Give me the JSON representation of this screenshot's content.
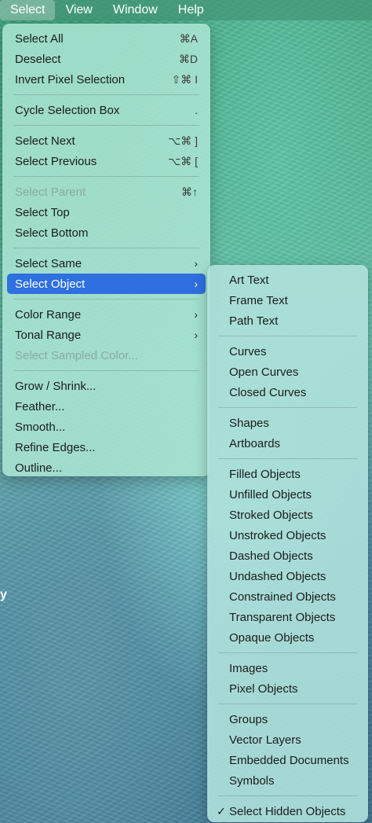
{
  "menubar": {
    "items": [
      {
        "label": "Select"
      },
      {
        "label": "View"
      },
      {
        "label": "Window"
      },
      {
        "label": "Help"
      }
    ]
  },
  "select_menu": {
    "items": [
      {
        "label": "Select All",
        "shortcut": "⌘A"
      },
      {
        "label": "Deselect",
        "shortcut": "⌘D"
      },
      {
        "label": "Invert Pixel Selection",
        "shortcut": "⇧⌘ I"
      },
      {
        "label": "Cycle Selection Box",
        "shortcut": "."
      },
      {
        "label": "Select Next",
        "shortcut": "⌥⌘ ]"
      },
      {
        "label": "Select Previous",
        "shortcut": "⌥⌘ ["
      },
      {
        "label": "Select Parent",
        "shortcut": "⌘↑"
      },
      {
        "label": "Select Top",
        "shortcut": ""
      },
      {
        "label": "Select Bottom",
        "shortcut": ""
      },
      {
        "label": "Select Same",
        "arrow": "›"
      },
      {
        "label": "Select Object",
        "arrow": "›"
      },
      {
        "label": "Color Range",
        "arrow": "›"
      },
      {
        "label": "Tonal Range",
        "arrow": "›"
      },
      {
        "label": "Select Sampled Color..."
      },
      {
        "label": "Grow / Shrink..."
      },
      {
        "label": "Feather..."
      },
      {
        "label": "Smooth..."
      },
      {
        "label": "Refine Edges..."
      },
      {
        "label": "Outline..."
      }
    ]
  },
  "select_object_submenu": {
    "items": [
      {
        "label": "Art Text"
      },
      {
        "label": "Frame Text"
      },
      {
        "label": "Path Text"
      },
      {
        "label": "Curves"
      },
      {
        "label": "Open Curves"
      },
      {
        "label": "Closed Curves"
      },
      {
        "label": "Shapes"
      },
      {
        "label": "Artboards"
      },
      {
        "label": "Filled Objects"
      },
      {
        "label": "Unfilled Objects"
      },
      {
        "label": "Stroked Objects"
      },
      {
        "label": "Unstroked Objects"
      },
      {
        "label": "Dashed Objects"
      },
      {
        "label": "Undashed Objects"
      },
      {
        "label": "Constrained Objects"
      },
      {
        "label": "Transparent Objects"
      },
      {
        "label": "Opaque Objects"
      },
      {
        "label": "Images"
      },
      {
        "label": "Pixel Objects"
      },
      {
        "label": "Groups"
      },
      {
        "label": "Vector Layers"
      },
      {
        "label": "Embedded Documents"
      },
      {
        "label": "Symbols"
      },
      {
        "label": "Select Hidden Objects",
        "checked": "✓"
      }
    ]
  },
  "stray_text": "y",
  "colors": {
    "highlight": "#2f6fe0",
    "menubar": "#46967a"
  }
}
